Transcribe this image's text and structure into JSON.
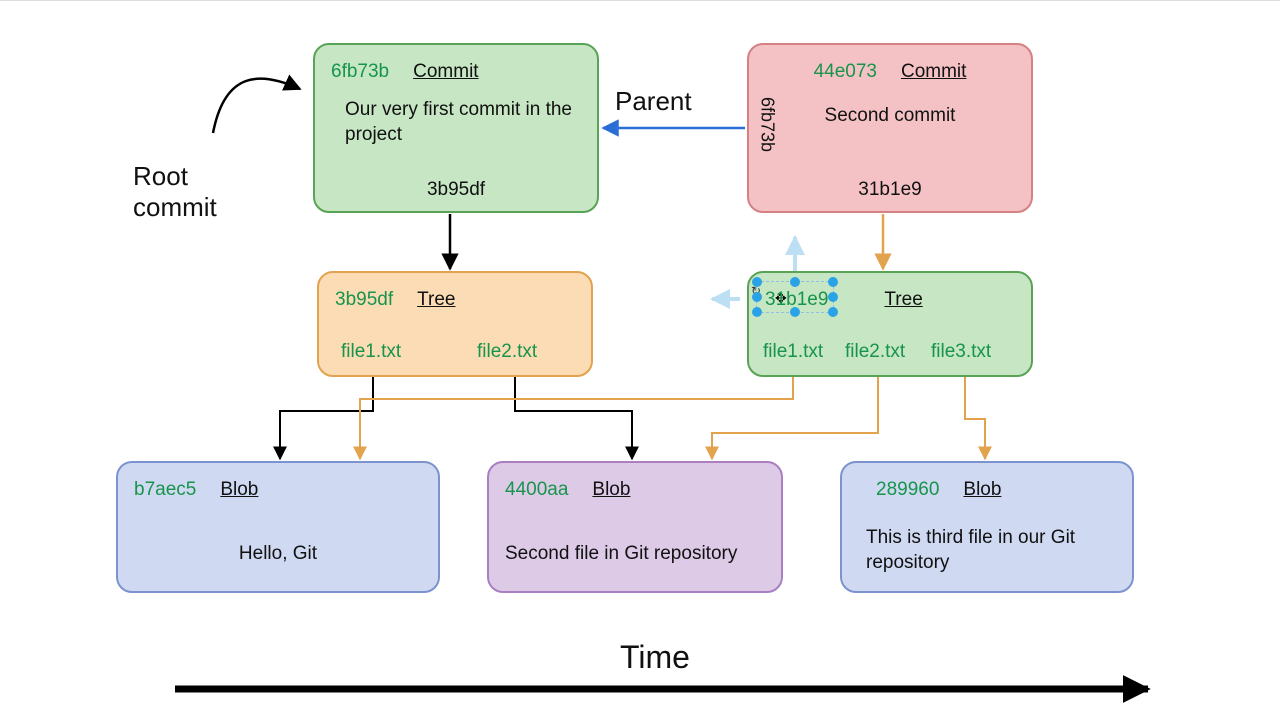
{
  "labels": {
    "root_commit": "Root\ncommit",
    "parent": "Parent",
    "time": "Time"
  },
  "commit1": {
    "hash": "6fb73b",
    "type": "Commit",
    "msg": "Our very first commit in the project",
    "tree_hash": "3b95df"
  },
  "commit2": {
    "hash": "44e073",
    "type": "Commit",
    "msg": "Second commit",
    "tree_hash": "31b1e9",
    "parent_hash": "6fb73b"
  },
  "tree1": {
    "hash": "3b95df",
    "type": "Tree",
    "files": [
      "file1.txt",
      "file2.txt"
    ]
  },
  "tree2": {
    "hash": "31b1e9",
    "type": "Tree",
    "files": [
      "file1.txt",
      "file2.txt",
      "file3.txt"
    ]
  },
  "blob1": {
    "hash": "b7aec5",
    "type": "Blob",
    "content": "Hello, Git"
  },
  "blob2": {
    "hash": "4400aa",
    "type": "Blob",
    "content": "Second file in Git repository"
  },
  "blob3": {
    "hash": "289960",
    "type": "Blob",
    "content": "This is third file in our Git repository"
  }
}
